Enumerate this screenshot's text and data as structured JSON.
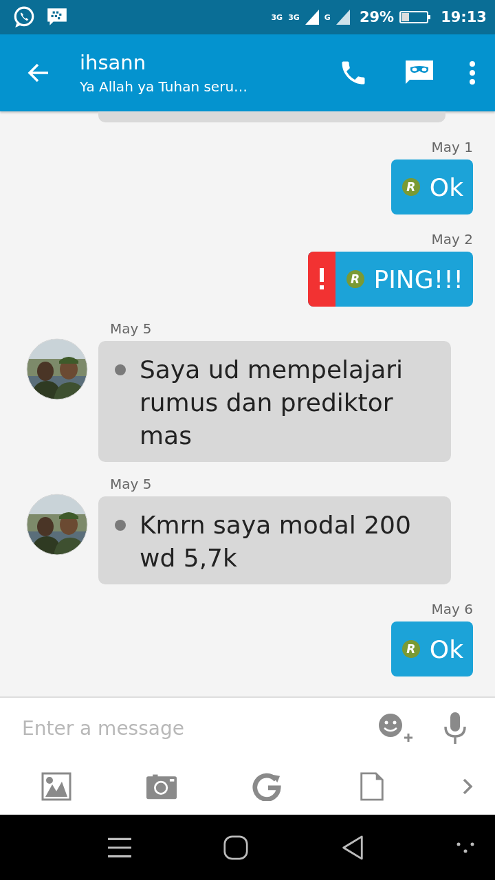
{
  "status_bar": {
    "data_type": "3G",
    "network_1": "3G",
    "network_2": "G",
    "battery": "29%",
    "time": "19:13"
  },
  "header": {
    "name": "ihsann",
    "status": "Ya Allah ya Tuhan seru…"
  },
  "messages": [
    {
      "kind": "outgoing",
      "date": "May 1",
      "read_mark": "R",
      "text": "Ok",
      "failed": false
    },
    {
      "kind": "outgoing",
      "date": "May 2",
      "read_mark": "R",
      "text": "PING!!!",
      "failed": true
    },
    {
      "kind": "incoming",
      "date": "May 5",
      "text": "Saya ud mempelajari rumus dan prediktor mas"
    },
    {
      "kind": "incoming",
      "date": "May 5",
      "text": "Kmrn saya modal 200 wd 5,7k"
    },
    {
      "kind": "outgoing",
      "date": "May 6",
      "read_mark": "R",
      "text": "Ok",
      "failed": false
    }
  ],
  "composer": {
    "placeholder": "Enter a message"
  }
}
